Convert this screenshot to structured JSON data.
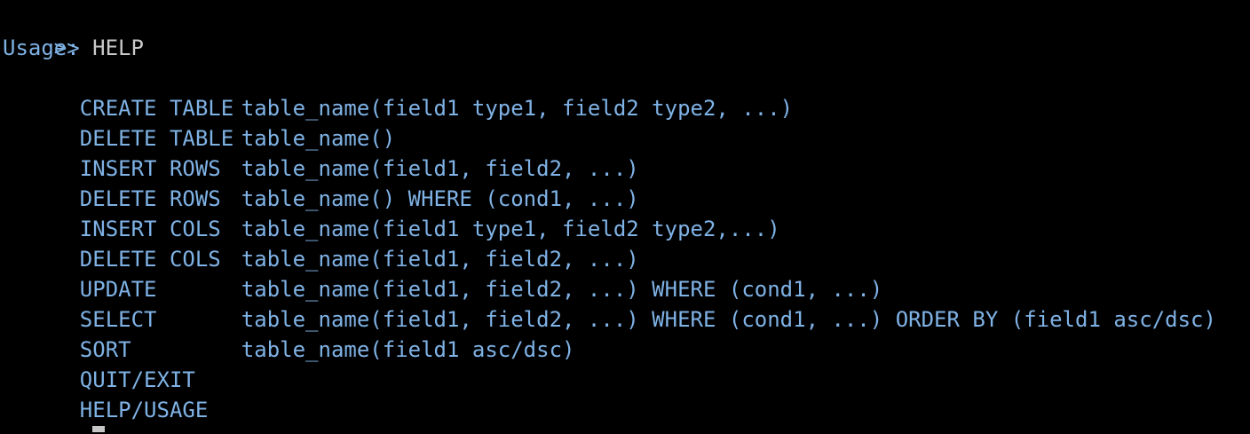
{
  "terminal": {
    "prompt": ">>",
    "command": "HELP",
    "usage_title": "Usage:",
    "usage": [
      {
        "keyword": "CREATE TABLE",
        "syntax": "table_name(field1 type1, field2 type2, ...)"
      },
      {
        "keyword": "DELETE TABLE",
        "syntax": "table_name()"
      },
      {
        "keyword": "INSERT ROWS",
        "syntax": "table_name(field1, field2, ...)"
      },
      {
        "keyword": "DELETE ROWS",
        "syntax": "table_name() WHERE (cond1, ...)"
      },
      {
        "keyword": "INSERT COLS",
        "syntax": "table_name(field1 type1, field2 type2,...)"
      },
      {
        "keyword": "DELETE COLS",
        "syntax": "table_name(field1, field2, ...)"
      },
      {
        "keyword": "UPDATE",
        "syntax": "table_name(field1, field2, ...) WHERE (cond1, ...)"
      },
      {
        "keyword": "SELECT",
        "syntax": "table_name(field1, field2, ...) WHERE (cond1, ...) ORDER BY (field1 asc/dsc)"
      },
      {
        "keyword": "SORT",
        "syntax": "table_name(field1 asc/dsc)"
      },
      {
        "keyword": "QUIT/EXIT",
        "syntax": ""
      },
      {
        "keyword": "HELP/USAGE",
        "syntax": ""
      }
    ],
    "current_prompt": ">>",
    "current_input": ""
  },
  "colors": {
    "background": "#000000",
    "usage_text": "#7fb2e5",
    "command_text": "#c9c9c9",
    "cursor": "#c6c6c6"
  }
}
